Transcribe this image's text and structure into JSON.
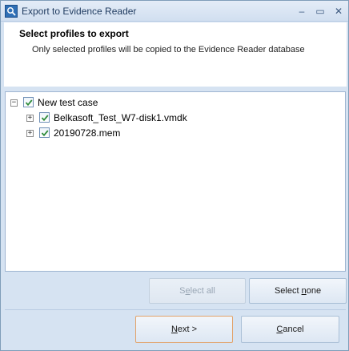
{
  "window": {
    "title": "Export to Evidence Reader",
    "controls": {
      "minimize": "–",
      "maximize": "▭",
      "close": "✕"
    }
  },
  "header": {
    "title": "Select profiles to export",
    "subtitle": "Only selected profiles will be copied to the Evidence Reader database"
  },
  "tree": {
    "root": {
      "label": "New test case",
      "expander": "−",
      "checked": true
    },
    "children": [
      {
        "label": "Belkasoft_Test_W7-disk1.vmdk",
        "expander": "+",
        "checked": true
      },
      {
        "label": "20190728.mem",
        "expander": "+",
        "checked": true
      }
    ]
  },
  "buttons": {
    "select_all": {
      "pre": "S",
      "mnemonic": "e",
      "post": "lect all",
      "enabled": false
    },
    "select_none": {
      "pre": "Select ",
      "mnemonic": "n",
      "post": "one",
      "enabled": true
    },
    "next": {
      "pre": "",
      "mnemonic": "N",
      "post": "ext >"
    },
    "cancel": {
      "pre": "",
      "mnemonic": "C",
      "post": "ancel"
    }
  },
  "colors": {
    "checkmark": "#2e8b3a",
    "window_bg": "#d6e3f2",
    "focus_border": "#e2a36b"
  }
}
